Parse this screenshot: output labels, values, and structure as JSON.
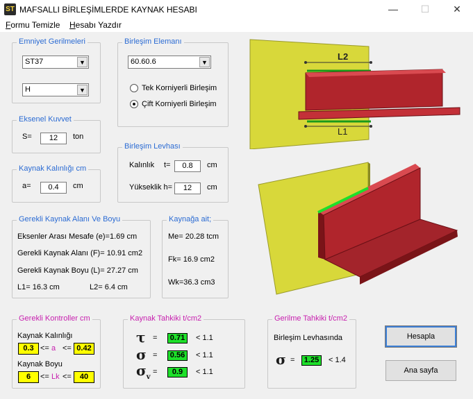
{
  "window": {
    "title": "MAFSALLI BİRLEŞİMLERDE KAYNAK HESABI",
    "icon_text": "ST"
  },
  "window_controls": {
    "minimize": "—",
    "maximize": "☐",
    "close": "✕"
  },
  "menu": {
    "item1_u": "F",
    "item1_rest": "ormu Temizle",
    "item2_u": "H",
    "item2_rest": "esabı Yazdır"
  },
  "emniyet": {
    "legend": "Emniyet Gerilmeleri",
    "steel": "ST37",
    "case": "H"
  },
  "birlesim_elemani": {
    "legend": "Birleşim Elemanı",
    "profile": "60.60.6",
    "option1": "Tek Korniyerli Birleşim",
    "option2": "Çift Korniyerli Birleşim",
    "selected": 2
  },
  "eksenel": {
    "legend": "Eksenel Kuvvet",
    "label": "S=",
    "value": "12",
    "unit": "ton"
  },
  "levha": {
    "legend": "Birleşim Levhası",
    "thickness_label": "Kalınlık",
    "thickness_var": "t=",
    "thickness_value": "0.8",
    "thickness_unit": "cm",
    "height_label": "Yükseklik h=",
    "height_value": "12",
    "height_unit": "cm"
  },
  "kalinlik": {
    "legend": "Kaynak Kalınlığı  cm",
    "label": "a=",
    "value": "0.4",
    "unit": "cm"
  },
  "gerekli_alan": {
    "legend": "Gerekli Kaynak Alanı Ve Boyu",
    "row1": "Eksenler Arası Mesafe (e)=1.69   cm",
    "row2": "Gerekli Kaynak Alanı (F)=   10.91  cm2",
    "row3": "Gerekli Kaynak Boyu (L)=    27.27  cm",
    "row4a": "L1=  16.3    cm",
    "row4b": "L2=  6.4     cm"
  },
  "kaynaga_ait": {
    "legend": "Kaynağa ait;",
    "me": "Me= 20.28  tcm",
    "fk": "Fk=  16.9    cm2",
    "wk": "Wk=36.3    cm3"
  },
  "kontroller": {
    "legend": "Gerekli Kontroller  cm",
    "kalinlik_label": "Kaynak Kalınlığı",
    "kalinlik_min": "0.3",
    "kalinlik_op1": "<=",
    "kalinlik_var": "a",
    "kalinlik_op2": "<=",
    "kalinlik_max": "0.42",
    "boy_label": "Kaynak Boyu",
    "boy_min": "6",
    "boy_op1": "<=",
    "boy_var": "Lk",
    "boy_op2": "<=",
    "boy_max": "40"
  },
  "kaynak_tahkiki": {
    "legend": "Kaynak Tahkiki   t/cm2",
    "tau_sym": "τ",
    "tau_val": "0.71",
    "tau_lim": "< 1.1",
    "sigma_sym": "σ",
    "sigma_val": "0.56",
    "sigma_lim": "< 1.1",
    "sigmav_sym": "σ",
    "sigmav_sub": "v",
    "sigmav_val": "0.9",
    "sigmav_lim": "< 1.1",
    "eq": "="
  },
  "gerilme": {
    "legend": "Gerilme Tahkiki   t/cm2",
    "label": "Birleşim Levhasında",
    "sym": "σ",
    "eq": "=",
    "value": "1.25",
    "limit": "< 1.4"
  },
  "buttons": {
    "hesapla": "Hesapla",
    "ana_sayfa": "Ana sayfa"
  },
  "diagram": {
    "label_top": "L2",
    "label_bottom": "L1"
  },
  "colors": {
    "accent": "#2b6bd3",
    "magenta": "#c71fae",
    "ok_green": "#1ee02a",
    "limit_yellow": "#ffff00",
    "plate_yellow": "#d8d83a",
    "angle_red": "#b0252c"
  }
}
